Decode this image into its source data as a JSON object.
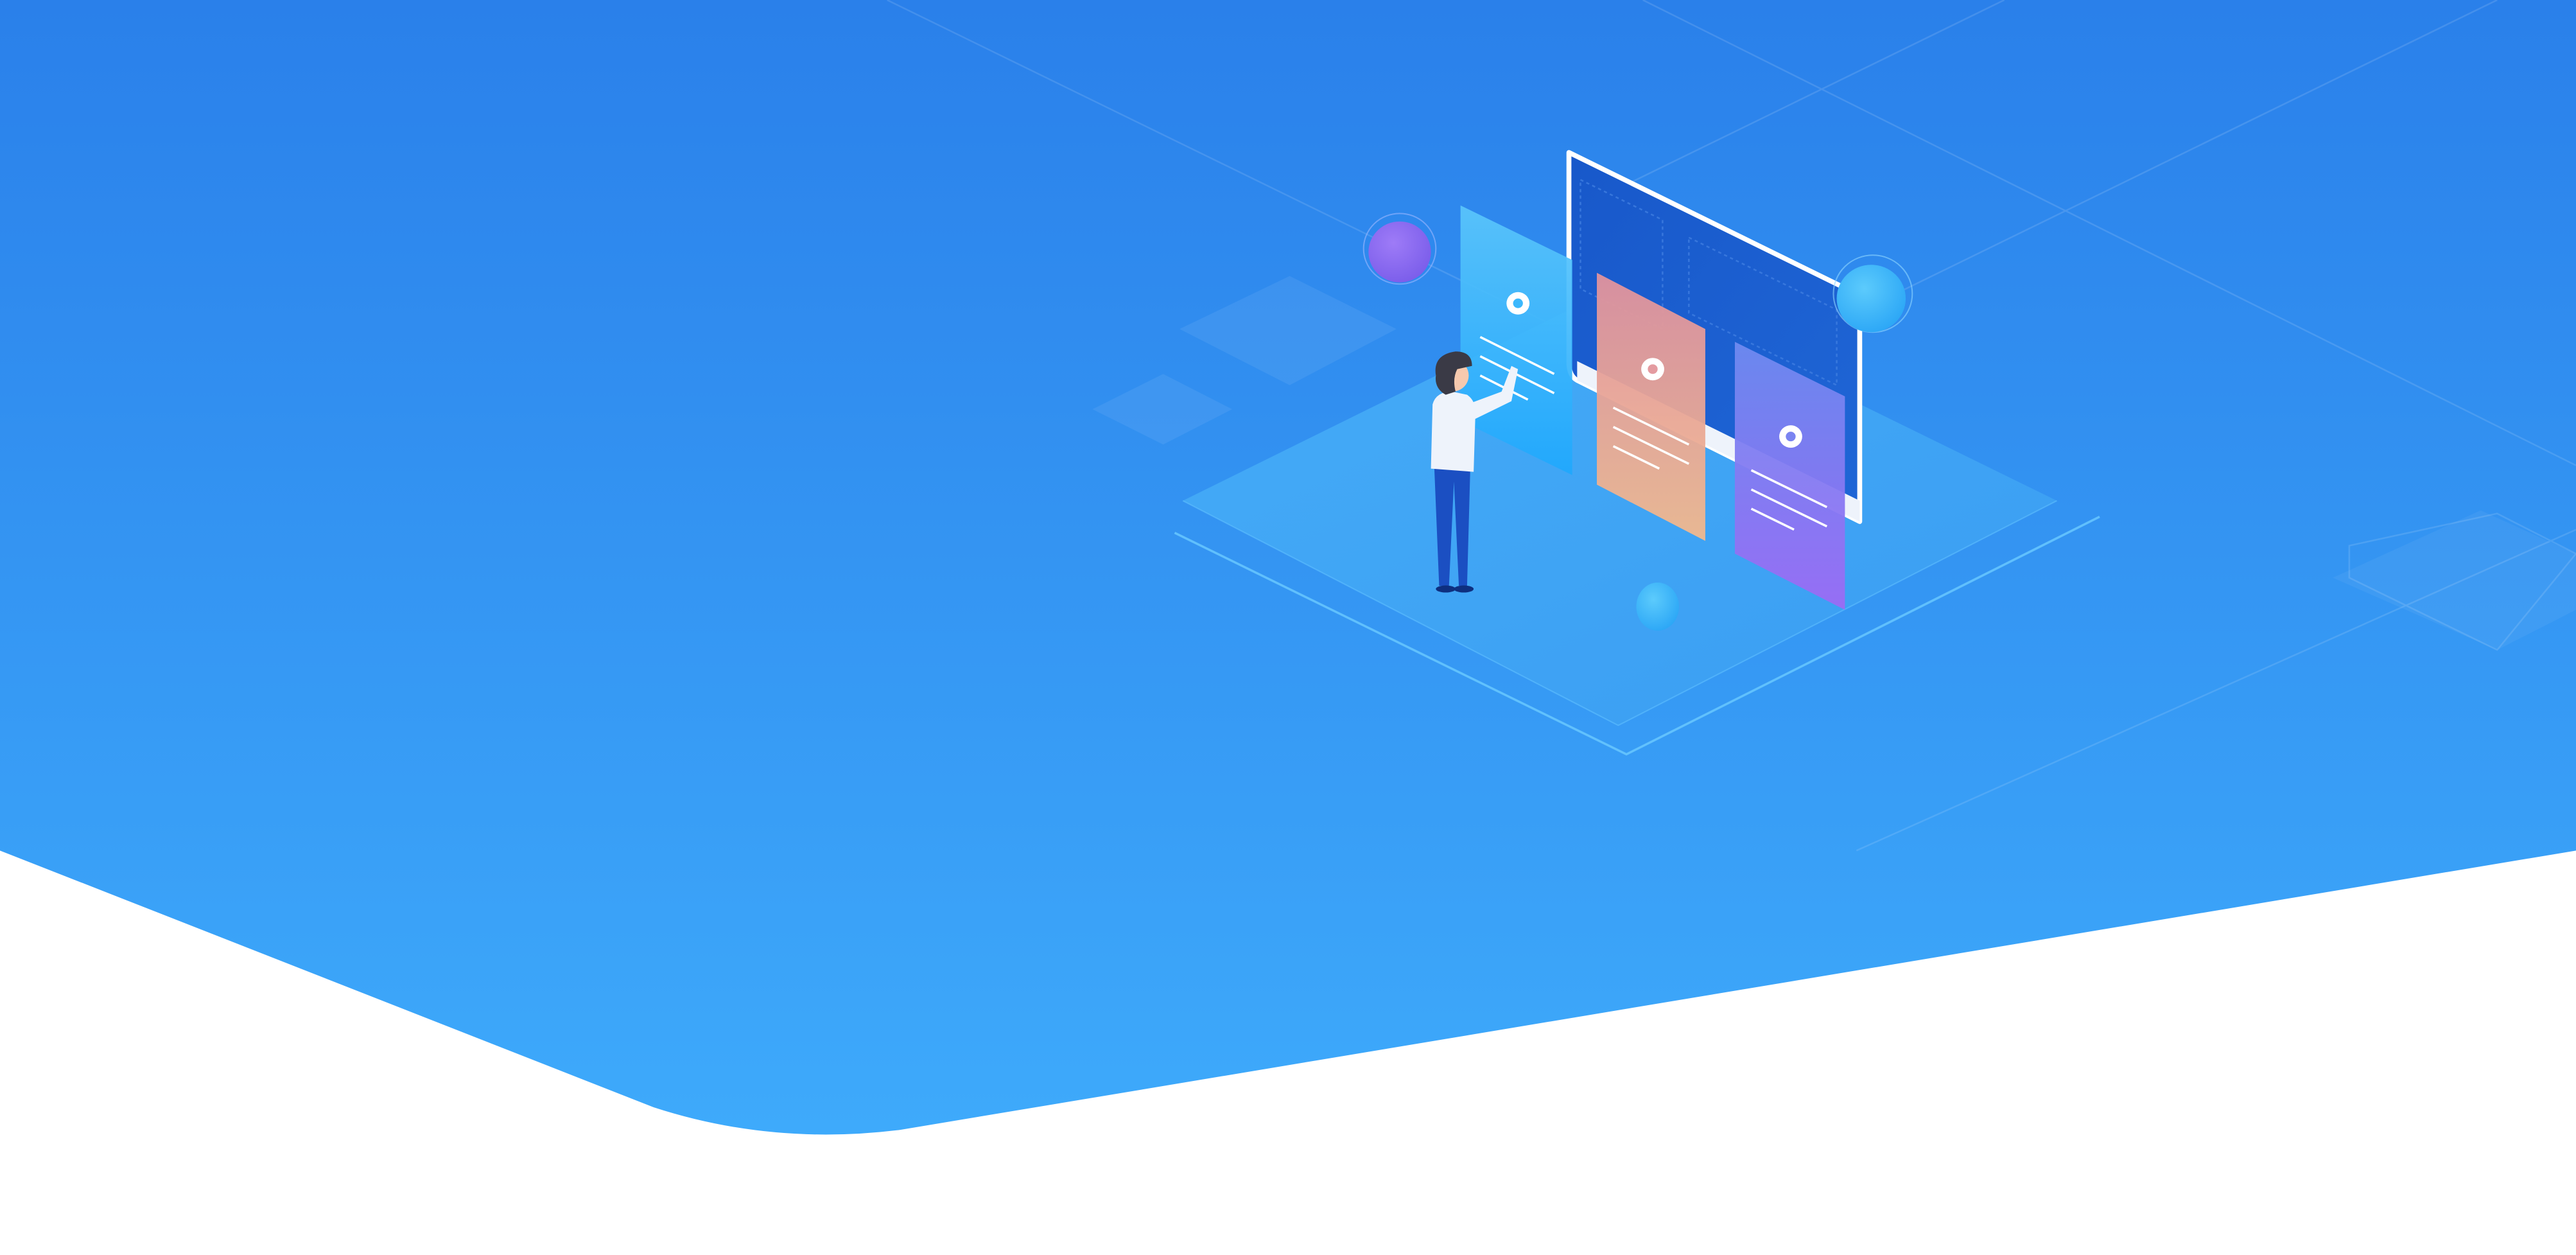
{
  "banner": {
    "gradient_top": "#2A80EA",
    "gradient_bottom": "#3EAAFB",
    "background": "#FFFFFF"
  },
  "illustration": {
    "platform_color": "#3FA3F5",
    "monitor_screen_color": "#1A5FCF",
    "monitor_frame_color": "#FFFFFF",
    "cards": [
      {
        "name": "card-cyan",
        "colors": [
          "#5BC6FB",
          "#1FA8FD"
        ],
        "icon": "gear-icon"
      },
      {
        "name": "card-peach",
        "colors": [
          "#E0929E",
          "#F1B98E"
        ],
        "icon": "gear-icon"
      },
      {
        "name": "card-violet",
        "colors": [
          "#6E8AF0",
          "#9B6BF4"
        ],
        "icon": "gear-icon"
      }
    ],
    "orbs": [
      {
        "name": "orb-purple",
        "color": "#8C6BF2"
      },
      {
        "name": "orb-cyan-right",
        "color": "#3FB8FA"
      },
      {
        "name": "orb-cyan-bottom",
        "color": "#49C3FB"
      }
    ],
    "figure": {
      "hair_color": "#3A3A46",
      "shirt_color": "#EEF3FB",
      "pants_color": "#1B4FC2"
    }
  }
}
